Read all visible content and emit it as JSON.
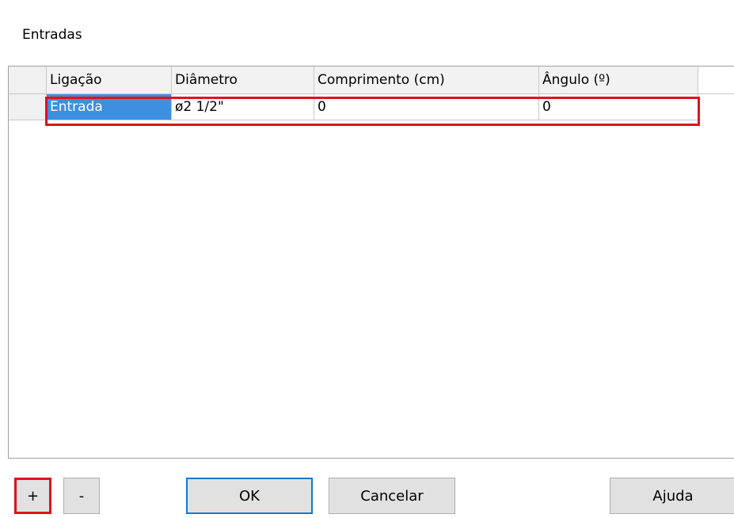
{
  "section": {
    "title": "Entradas"
  },
  "table": {
    "columns": [
      "Ligação",
      "Diâmetro",
      "Comprimento (cm)",
      "Ângulo (º)"
    ],
    "rows": [
      {
        "ligacao": "Entrada",
        "diametro": "ø2 1/2\"",
        "comprimento": "0",
        "angulo": "0"
      }
    ]
  },
  "buttons": {
    "add": "+",
    "remove": "-",
    "ok": "OK",
    "cancel": "Cancelar",
    "help": "Ajuda"
  },
  "colors": {
    "selection": "#3d8fe0",
    "highlight": "#e0121a",
    "default_button_border": "#0f78d7"
  }
}
